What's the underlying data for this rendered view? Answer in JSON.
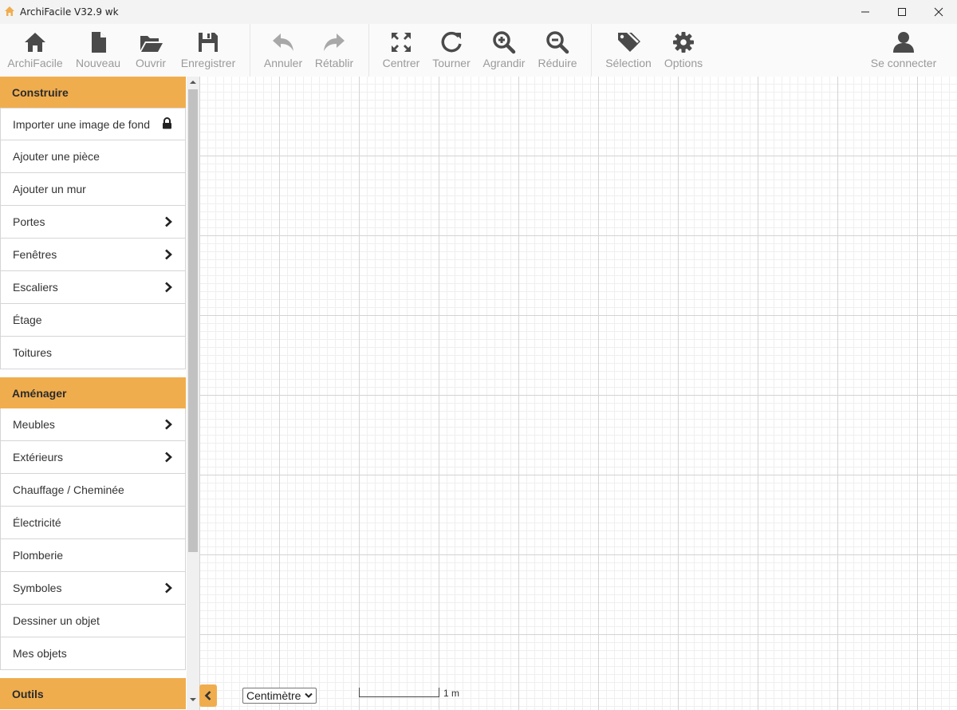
{
  "window": {
    "title": "ArchiFacile V32.9 wk",
    "controls": [
      "minimize",
      "maximize",
      "close"
    ]
  },
  "toolbar": {
    "groups": [
      [
        {
          "label": "ArchiFacile",
          "icon": "home-icon"
        },
        {
          "label": "Nouveau",
          "icon": "new-file-icon"
        },
        {
          "label": "Ouvrir",
          "icon": "folder-open-icon"
        },
        {
          "label": "Enregistrer",
          "icon": "save-icon"
        }
      ],
      [
        {
          "label": "Annuler",
          "icon": "undo-icon"
        },
        {
          "label": "Rétablir",
          "icon": "redo-icon"
        }
      ],
      [
        {
          "label": "Centrer",
          "icon": "expand-icon"
        },
        {
          "label": "Tourner",
          "icon": "rotate-icon"
        },
        {
          "label": "Agrandir",
          "icon": "zoom-in-icon"
        },
        {
          "label": "Réduire",
          "icon": "zoom-out-icon"
        }
      ],
      [
        {
          "label": "Sélection",
          "icon": "tags-icon"
        },
        {
          "label": "Options",
          "icon": "gear-icon"
        }
      ]
    ],
    "account": {
      "label": "Se connecter",
      "icon": "user-icon"
    }
  },
  "sidebar": {
    "sections": [
      {
        "title": "Construire",
        "items": [
          {
            "label": "Importer une image de fond",
            "indicator": "lock-icon"
          },
          {
            "label": "Ajouter une pièce",
            "indicator": ""
          },
          {
            "label": "Ajouter un mur",
            "indicator": ""
          },
          {
            "label": "Portes",
            "indicator": "chevron-right-icon"
          },
          {
            "label": "Fenêtres",
            "indicator": "chevron-right-icon"
          },
          {
            "label": "Escaliers",
            "indicator": "chevron-right-icon"
          },
          {
            "label": "Étage",
            "indicator": ""
          },
          {
            "label": "Toitures",
            "indicator": ""
          }
        ]
      },
      {
        "title": "Aménager",
        "items": [
          {
            "label": "Meubles",
            "indicator": "chevron-right-icon"
          },
          {
            "label": "Extérieurs",
            "indicator": "chevron-right-icon"
          },
          {
            "label": "Chauffage / Cheminée",
            "indicator": ""
          },
          {
            "label": "Électricité",
            "indicator": ""
          },
          {
            "label": "Plomberie",
            "indicator": ""
          },
          {
            "label": "Symboles",
            "indicator": "chevron-right-icon"
          },
          {
            "label": "Dessiner un objet",
            "indicator": ""
          },
          {
            "label": "Mes objets",
            "indicator": ""
          }
        ]
      },
      {
        "title": "Outils",
        "items": []
      }
    ]
  },
  "statusbar": {
    "unit_selected": "Centimètre",
    "scale_label": "1 m"
  },
  "colors": {
    "accent": "#f0ad4e",
    "toolbar_icon": "#4a4a4a",
    "toolbar_icon_disabled": "#a8a8a8",
    "toolbar_label": "#9a9a9a"
  }
}
